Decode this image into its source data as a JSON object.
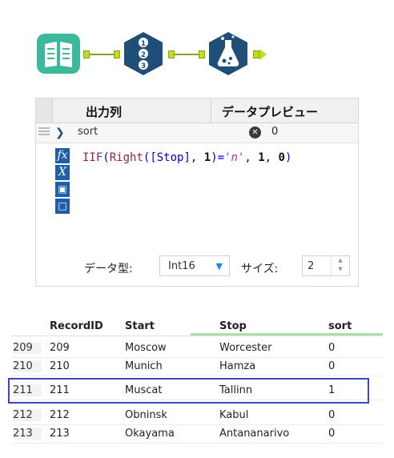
{
  "config": {
    "header": {
      "output_col": "出力列",
      "preview": "データプレビュー"
    },
    "field": {
      "name": "sort",
      "preview_value": "0"
    },
    "toolbar": {
      "fx": "fx",
      "x": "X"
    },
    "expression": {
      "fn1": "IIF",
      "fn2": "Right",
      "field": "[Stop]",
      "arg1": "1",
      "op": "=",
      "literal": "'n'",
      "true_val": "1",
      "false_val": "0"
    },
    "type_label": "データ型:",
    "type_value": "Int16",
    "size_label": "サイズ:",
    "size_value": "2"
  },
  "table": {
    "columns": [
      "RecordID",
      "Start",
      "Stop",
      "sort"
    ],
    "rows": [
      {
        "num": "209",
        "id": "209",
        "start": "Moscow",
        "stop": "Worcester",
        "sort": "0"
      },
      {
        "num": "210",
        "id": "210",
        "start": "Munich",
        "stop": "Hamza",
        "sort": "0"
      },
      {
        "num": "211",
        "id": "211",
        "start": "Muscat",
        "stop": "Tallinn",
        "sort": "1"
      },
      {
        "num": "212",
        "id": "212",
        "start": "Obninsk",
        "stop": "Kabul",
        "sort": "0"
      },
      {
        "num": "213",
        "id": "213",
        "start": "Okayama",
        "stop": "Antananarivo",
        "sort": "0"
      }
    ],
    "highlighted_row": "211"
  },
  "colors": {
    "brand_green": "#3cb89c",
    "tool_blue": "#1e5faa",
    "highlight": "#3b46b8"
  },
  "icons": [
    "book-input-icon",
    "record-id-icon",
    "formula-flask-icon"
  ]
}
